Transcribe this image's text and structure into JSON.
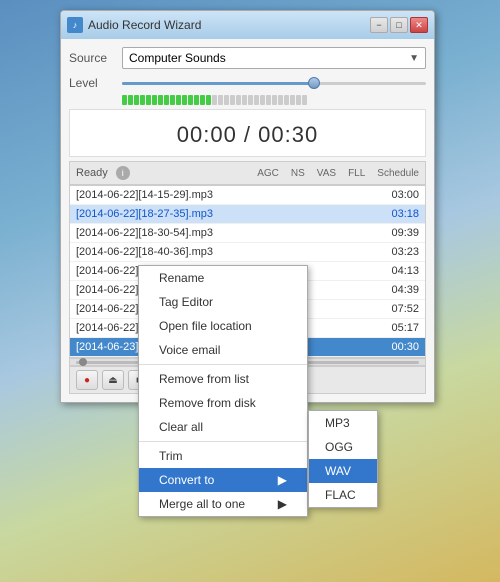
{
  "window": {
    "title": "Audio Record Wizard",
    "title_icon": "♪",
    "minimize_btn": "−",
    "maximize_btn": "□",
    "close_btn": "✕"
  },
  "source": {
    "label": "Source",
    "value": "Computer Sounds",
    "dropdown_arrow": "▼"
  },
  "level": {
    "label": "Level"
  },
  "timer": {
    "current": "00:00",
    "separator": " / ",
    "total": "00:30",
    "full": "00:00 / 00:30"
  },
  "status_bar": {
    "ready_text": "Ready",
    "badge": "i",
    "agc": "AGC",
    "ns": "NS",
    "vas": "VAS",
    "fll": "FLL",
    "schedule": "Schedule"
  },
  "files": [
    {
      "name": "[2014-06-22][14-15-29].mp3",
      "time": "03:00",
      "selected": false,
      "active": false
    },
    {
      "name": "[2014-06-22][18-27-35].mp3",
      "time": "03:18",
      "selected": true,
      "active": false
    },
    {
      "name": "[2014-06-22][18-30-54].mp3",
      "time": "09:39",
      "selected": false,
      "active": false
    },
    {
      "name": "[2014-06-22][18-40-36].mp3",
      "time": "03:23",
      "selected": false,
      "active": false
    },
    {
      "name": "[2014-06-22][18-44-01].mp3",
      "time": "04:13",
      "selected": false,
      "active": false
    },
    {
      "name": "[2014-06-22][18-48-19].mp3",
      "time": "04:39",
      "selected": false,
      "active": false
    },
    {
      "name": "[2014-06-22][18-53-05].mp3",
      "time": "07:52",
      "selected": false,
      "active": false
    },
    {
      "name": "[2014-06-22][19-00-58].mp3",
      "time": "05:17",
      "selected": false,
      "active": false
    },
    {
      "name": "[2014-06-23][18-04-46].mp3",
      "time": "00:30",
      "selected": false,
      "active": true
    }
  ],
  "controls": {
    "record": "●",
    "eject": "⏏",
    "stop": "■"
  },
  "context_menu": {
    "items": [
      {
        "label": "Rename",
        "has_submenu": false,
        "highlighted": false,
        "divider_before": false
      },
      {
        "label": "Tag Editor",
        "has_submenu": false,
        "highlighted": false,
        "divider_before": false
      },
      {
        "label": "Open file location",
        "has_submenu": false,
        "highlighted": false,
        "divider_before": false
      },
      {
        "label": "Voice email",
        "has_submenu": false,
        "highlighted": false,
        "divider_before": false
      },
      {
        "label": "Remove from list",
        "has_submenu": false,
        "highlighted": false,
        "divider_before": true
      },
      {
        "label": "Remove from disk",
        "has_submenu": false,
        "highlighted": false,
        "divider_before": false
      },
      {
        "label": "Clear all",
        "has_submenu": false,
        "highlighted": false,
        "divider_before": false
      },
      {
        "label": "Trim",
        "has_submenu": false,
        "highlighted": false,
        "divider_before": true
      },
      {
        "label": "Convert to",
        "has_submenu": true,
        "highlighted": true,
        "divider_before": false
      },
      {
        "label": "Merge all to one",
        "has_submenu": true,
        "highlighted": false,
        "divider_before": false
      }
    ],
    "submenu_arrow": "▶"
  },
  "submenu": {
    "items": [
      {
        "label": "MP3",
        "selected": false
      },
      {
        "label": "OGG",
        "selected": false
      },
      {
        "label": "WAV",
        "selected": true
      },
      {
        "label": "FLAC",
        "selected": false
      }
    ]
  }
}
